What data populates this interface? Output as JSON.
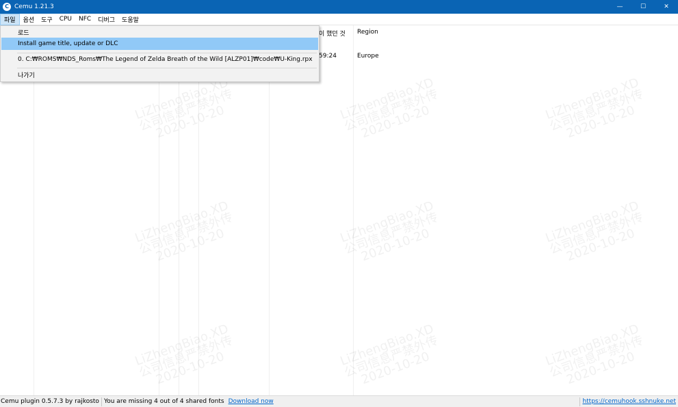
{
  "window": {
    "title": "Cemu 1.21.3",
    "app_icon_glyph": "C",
    "controls": {
      "minimize": "—",
      "maximize": "☐",
      "close": "✕"
    }
  },
  "menubar": {
    "items": [
      "파일",
      "옵션",
      "도구",
      "CPU",
      "NFC",
      "디버그",
      "도움말"
    ]
  },
  "file_menu": {
    "items": [
      "로드",
      "Install game title, update or DLC",
      "0. C:₩ROMS₩NDS_Roms₩The Legend of Zelda Breath of the Wild [ALZP01]₩code₩U-King.rpx",
      "나가기"
    ]
  },
  "game_list": {
    "header_last_played": "이 했던 것",
    "header_region": "Region",
    "row": {
      "last_played_time": "59:24",
      "region": "Europe"
    }
  },
  "watermark": {
    "line1": "LiZhengBiao.XD",
    "line2": "公司信息严禁外传",
    "line3": "2020-10-20"
  },
  "statusbar": {
    "plugin": "Cemu plugin 0.5.7.3 by rajkosto",
    "fonts_msg": "You are missing 4 out of 4 shared fonts",
    "download_link": "Download now",
    "site_link": "https://cemuhook.sshnuke.net"
  },
  "colors": {
    "titlebar": "#0a64b4",
    "menu_highlight": "#91c9f7",
    "link": "#0066cc"
  }
}
